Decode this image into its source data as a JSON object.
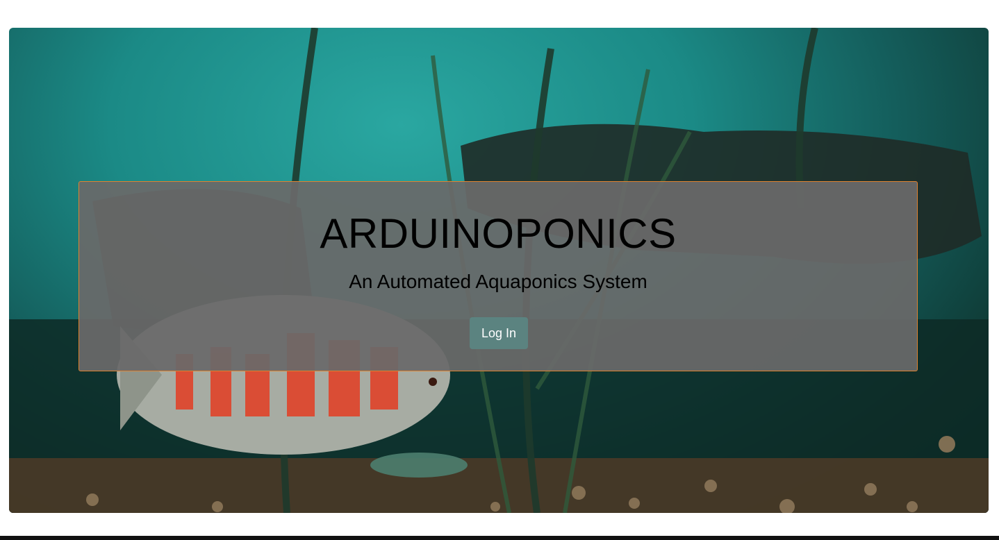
{
  "hero": {
    "title": "ARDUINOPONICS",
    "subtitle": "An Automated Aquaponics System",
    "login_label": "Log In",
    "background_image": "aquarium-fish-photo"
  },
  "colors": {
    "panel_border": "#e0822f",
    "button_bg": "#5b8380",
    "water": "#1b8a86"
  }
}
